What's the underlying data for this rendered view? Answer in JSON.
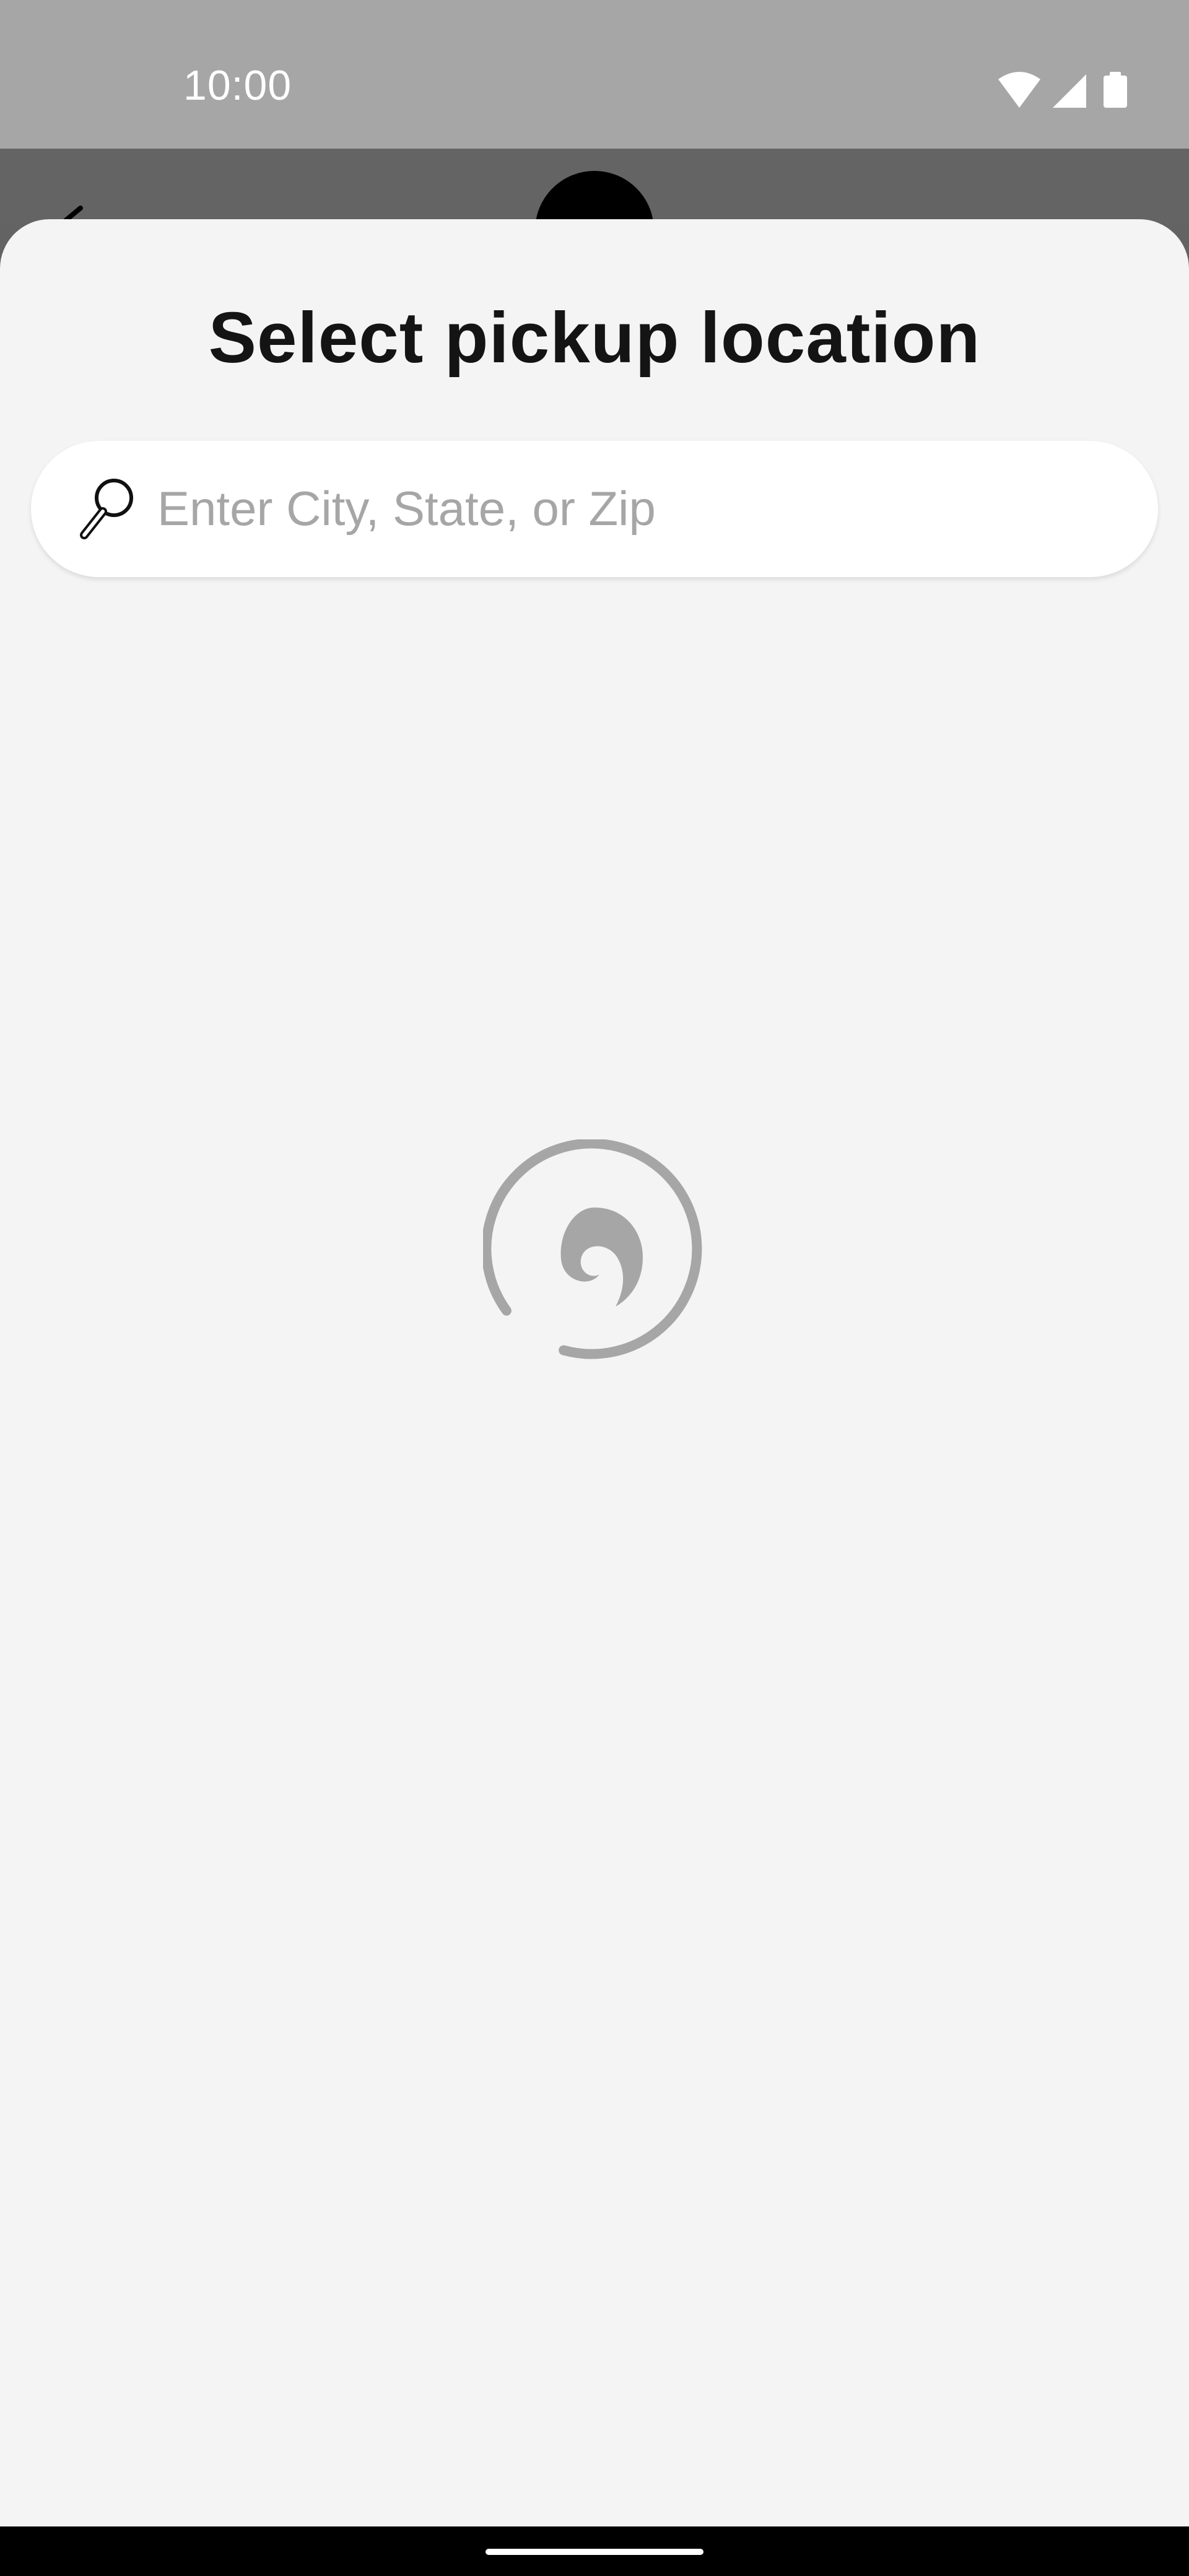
{
  "status_bar": {
    "time": "10:00",
    "icons": [
      "wifi-icon",
      "cellular-signal-icon",
      "battery-icon"
    ]
  },
  "underlay": {
    "icons": [
      "back-arrow-icon",
      "brand-logo-icon"
    ]
  },
  "sheet": {
    "title": "Select pickup location",
    "search": {
      "placeholder": "Enter City, State, or Zip",
      "value": "",
      "icon": "search-icon"
    },
    "loading_icon": "loading-spinner-icon"
  },
  "colors": {
    "status_bar": "#a6a6a6",
    "overlay": "#636363",
    "sheet_background": "#f4f4f4",
    "search_background": "#ffffff",
    "placeholder_text": "#a6a6a6",
    "spinner": "#a6a6a6",
    "title_text": "#141414",
    "nav_bar": "#000000"
  }
}
